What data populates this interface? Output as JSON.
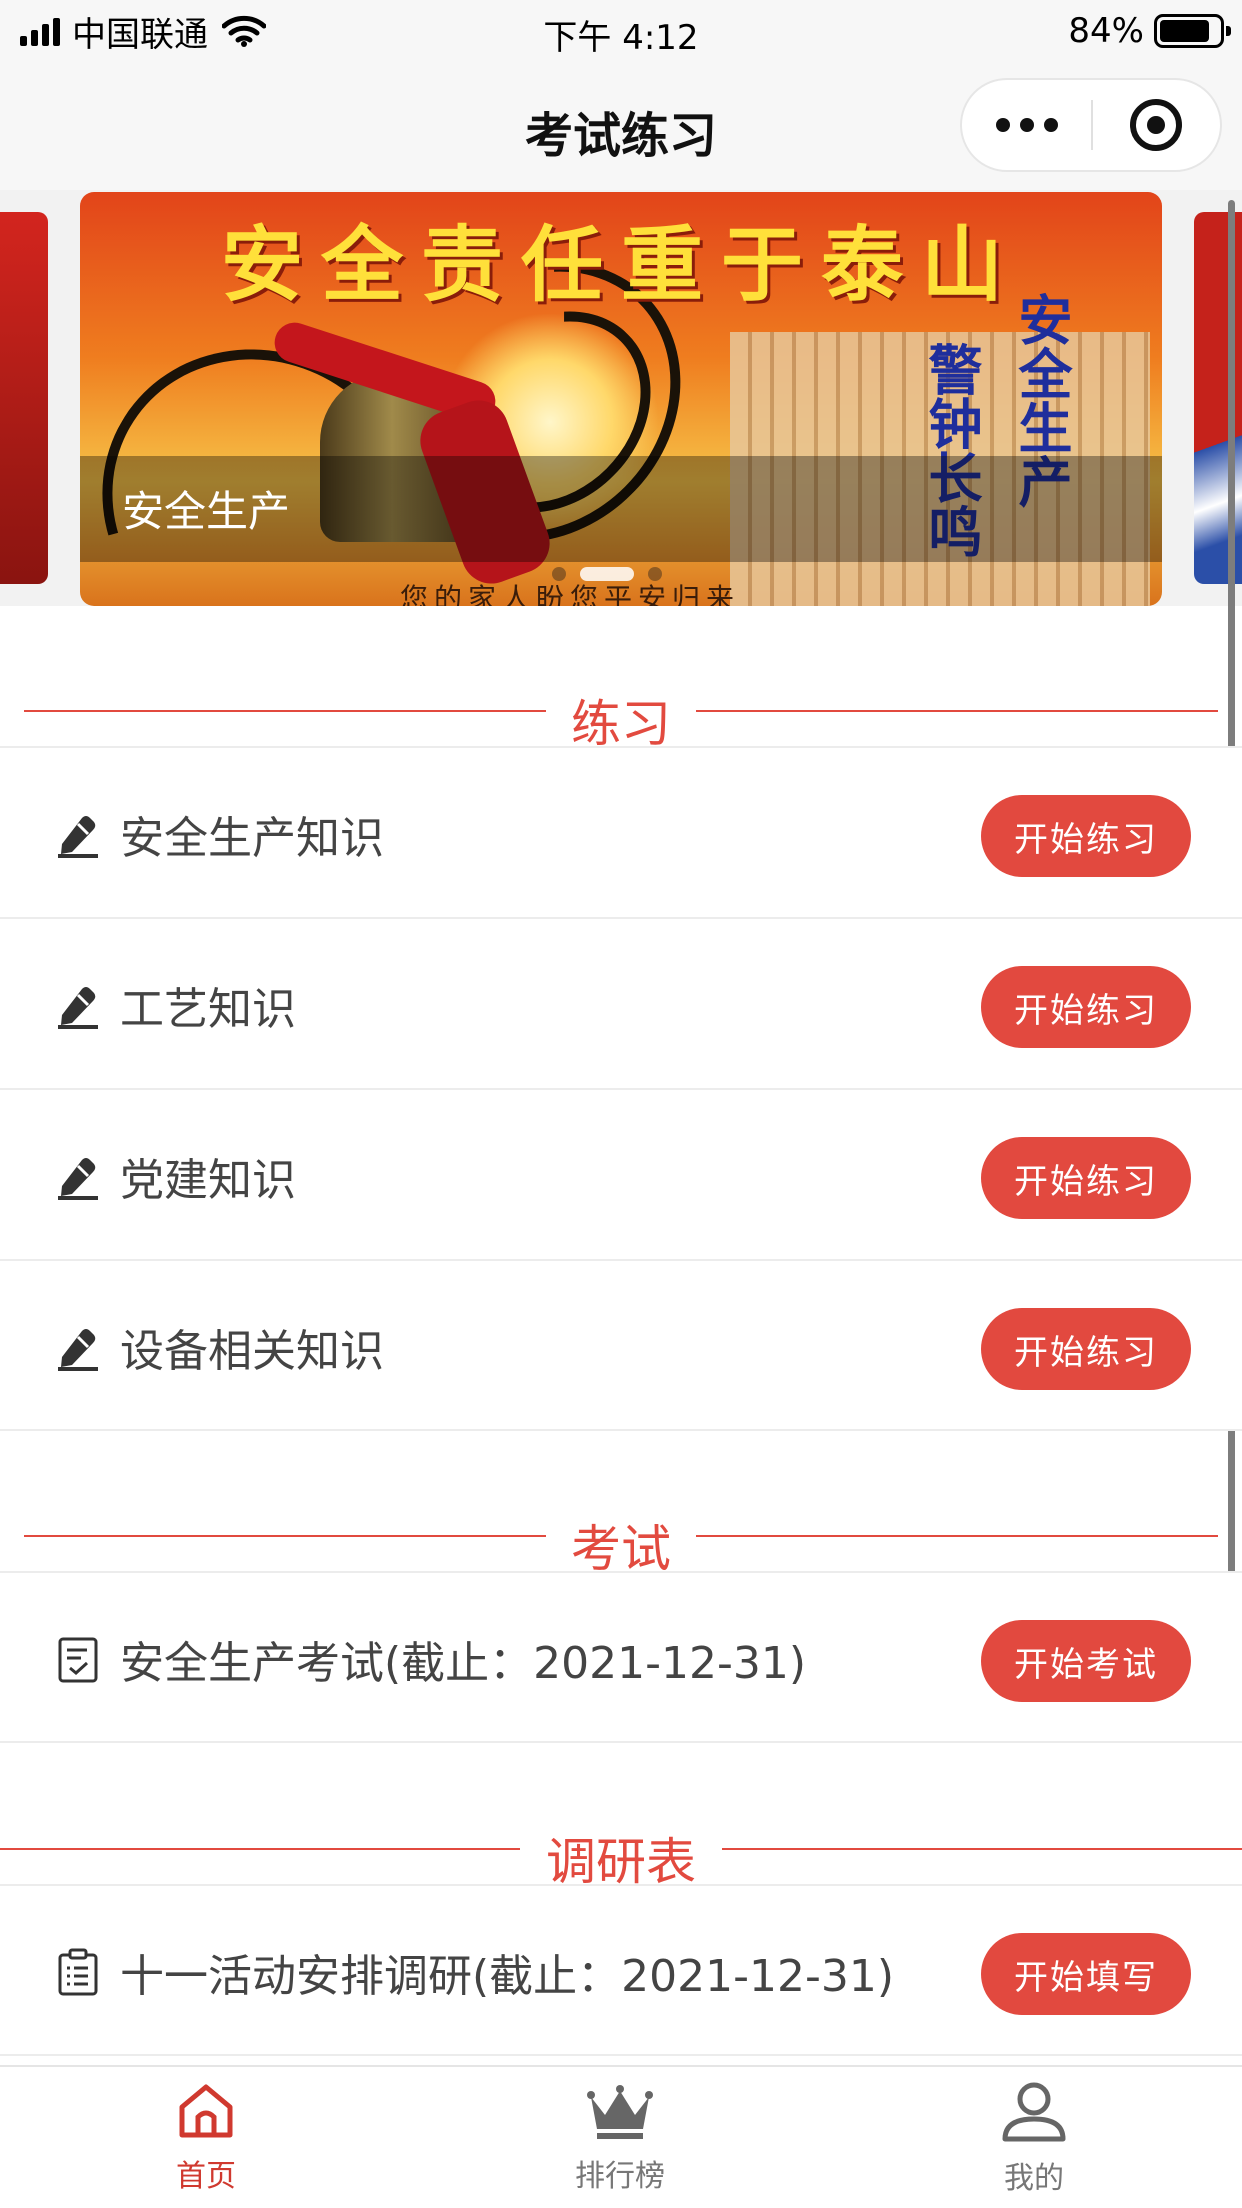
{
  "status_bar": {
    "carrier": "中国联通",
    "time": "下午 4:12",
    "battery": "84%",
    "battery_level": 0.84
  },
  "nav": {
    "title": "考试练习"
  },
  "banner": {
    "headline": "安全责任重于泰山",
    "slogan_right": "安全生产",
    "slogan_middle": "警钟长鸣",
    "caption": "安全生产",
    "bottom_text": "您的家人盼您平安归来",
    "slide_count": 3,
    "active_slide": 2
  },
  "sections": {
    "practice_title": "练习",
    "exam_title": "考试",
    "survey_title": "调研表"
  },
  "practice_items": [
    {
      "label": "安全生产知识",
      "button": "开始练习"
    },
    {
      "label": "工艺知识",
      "button": "开始练习"
    },
    {
      "label": "党建知识",
      "button": "开始练习"
    },
    {
      "label": "设备相关知识",
      "button": "开始练习"
    }
  ],
  "exam_items": [
    {
      "label": "安全生产考试(截止：2021-12-31)",
      "button": "开始考试"
    }
  ],
  "survey_items": [
    {
      "label": "十一活动安排调研(截止：2021-12-31)",
      "button": "开始填写"
    }
  ],
  "tabbar": {
    "items": [
      {
        "label": "首页",
        "icon": "home-icon",
        "active": true
      },
      {
        "label": "排行榜",
        "icon": "crown-icon",
        "active": false
      },
      {
        "label": "我的",
        "icon": "user-icon",
        "active": false
      }
    ]
  },
  "colors": {
    "accent": "#e2493f",
    "active_tab": "#d0392f"
  }
}
